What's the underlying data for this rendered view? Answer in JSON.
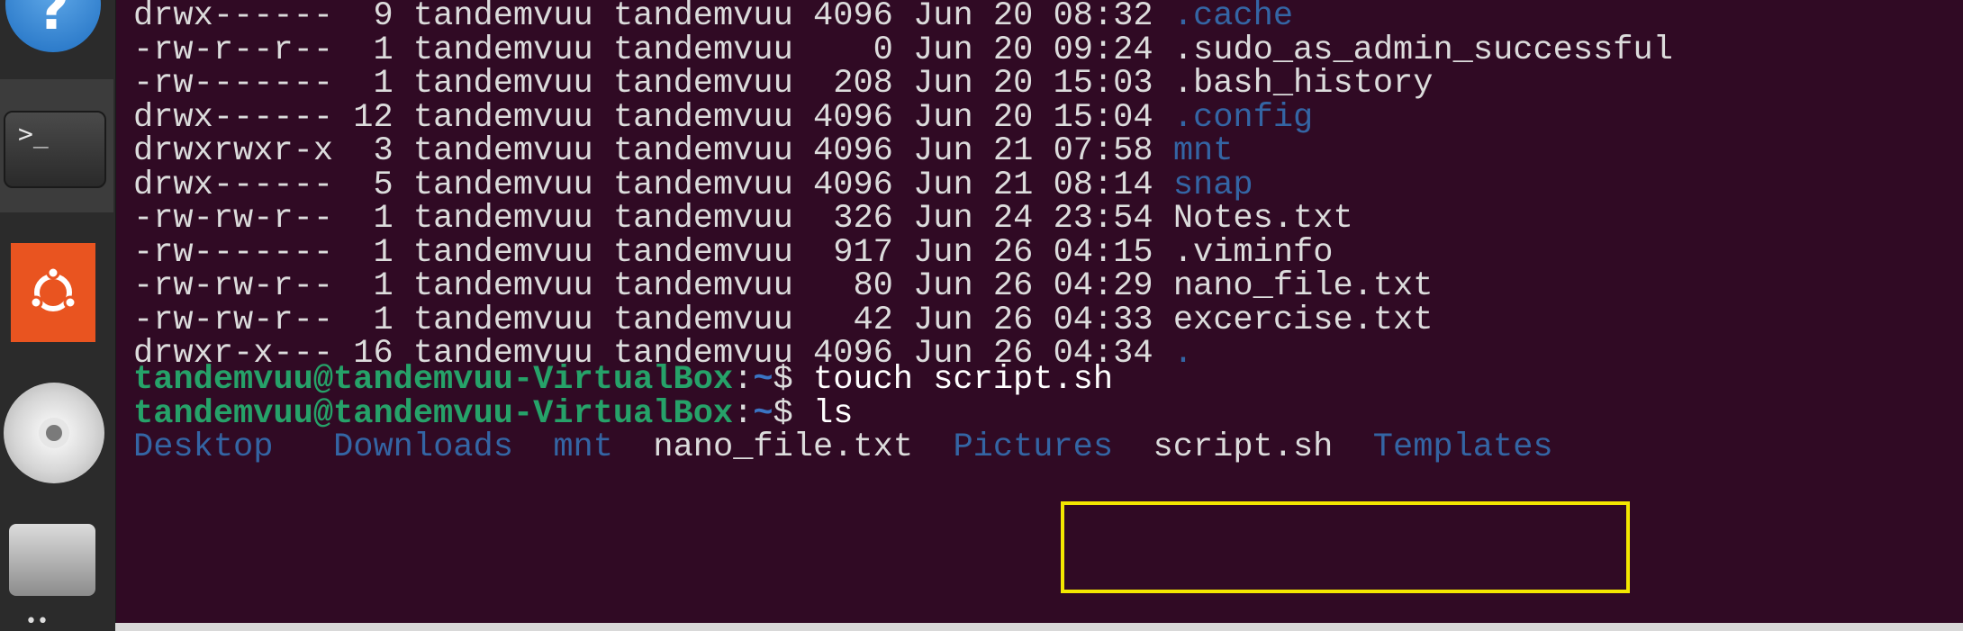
{
  "dock": {
    "help_glyph": "?",
    "terminal_glyph": ">_",
    "more_glyph": "••"
  },
  "listing": [
    {
      "perms": "drwx------",
      "links": " 9",
      "owner": "tandemvuu",
      "group": "tandemvuu",
      "size": "4096",
      "month": "Jun",
      "day": "20",
      "time": "08:32",
      "name": ".cache",
      "is_dir": true
    },
    {
      "perms": "-rw-r--r--",
      "links": " 1",
      "owner": "tandemvuu",
      "group": "tandemvuu",
      "size": "   0",
      "month": "Jun",
      "day": "20",
      "time": "09:24",
      "name": ".sudo_as_admin_successful",
      "is_dir": false
    },
    {
      "perms": "-rw-------",
      "links": " 1",
      "owner": "tandemvuu",
      "group": "tandemvuu",
      "size": " 208",
      "month": "Jun",
      "day": "20",
      "time": "15:03",
      "name": ".bash_history",
      "is_dir": false
    },
    {
      "perms": "drwx------",
      "links": "12",
      "owner": "tandemvuu",
      "group": "tandemvuu",
      "size": "4096",
      "month": "Jun",
      "day": "20",
      "time": "15:04",
      "name": ".config",
      "is_dir": true
    },
    {
      "perms": "drwxrwxr-x",
      "links": " 3",
      "owner": "tandemvuu",
      "group": "tandemvuu",
      "size": "4096",
      "month": "Jun",
      "day": "21",
      "time": "07:58",
      "name": "mnt",
      "is_dir": true
    },
    {
      "perms": "drwx------",
      "links": " 5",
      "owner": "tandemvuu",
      "group": "tandemvuu",
      "size": "4096",
      "month": "Jun",
      "day": "21",
      "time": "08:14",
      "name": "snap",
      "is_dir": true
    },
    {
      "perms": "-rw-rw-r--",
      "links": " 1",
      "owner": "tandemvuu",
      "group": "tandemvuu",
      "size": " 326",
      "month": "Jun",
      "day": "24",
      "time": "23:54",
      "name": "Notes.txt",
      "is_dir": false
    },
    {
      "perms": "-rw-------",
      "links": " 1",
      "owner": "tandemvuu",
      "group": "tandemvuu",
      "size": " 917",
      "month": "Jun",
      "day": "26",
      "time": "04:15",
      "name": ".viminfo",
      "is_dir": false
    },
    {
      "perms": "-rw-rw-r--",
      "links": " 1",
      "owner": "tandemvuu",
      "group": "tandemvuu",
      "size": "  80",
      "month": "Jun",
      "day": "26",
      "time": "04:29",
      "name": "nano_file.txt",
      "is_dir": false
    },
    {
      "perms": "-rw-rw-r--",
      "links": " 1",
      "owner": "tandemvuu",
      "group": "tandemvuu",
      "size": "  42",
      "month": "Jun",
      "day": "26",
      "time": "04:33",
      "name": "excercise.txt",
      "is_dir": false
    },
    {
      "perms": "drwxr-x---",
      "links": "16",
      "owner": "tandemvuu",
      "group": "tandemvuu",
      "size": "4096",
      "month": "Jun",
      "day": "26",
      "time": "04:34",
      "name": ".",
      "is_dir": true
    }
  ],
  "prompts": [
    {
      "user_host": "tandemvuu@tandemvuu-VirtualBox",
      "colon": ":",
      "path": "~",
      "dollar": "$",
      "command": "touch script.sh"
    },
    {
      "user_host": "tandemvuu@tandemvuu-VirtualBox",
      "colon": ":",
      "path": "~",
      "dollar": "$",
      "command": "ls"
    }
  ],
  "ls_output": [
    {
      "name": "Desktop",
      "is_dir": true
    },
    {
      "name": "Downloads",
      "is_dir": true
    },
    {
      "name": "mnt",
      "is_dir": true
    },
    {
      "name": "nano_file.txt",
      "is_dir": false
    },
    {
      "name": "Pictures",
      "is_dir": true
    },
    {
      "name": "script.sh",
      "is_dir": false
    },
    {
      "name": "Templates",
      "is_dir": true
    }
  ],
  "colors": {
    "background": "#300a24",
    "text": "#dcdcdc",
    "directory": "#3465a4",
    "prompt_user": "#26a269",
    "prompt_path": "#3a75c4",
    "highlight": "#f3e600"
  }
}
